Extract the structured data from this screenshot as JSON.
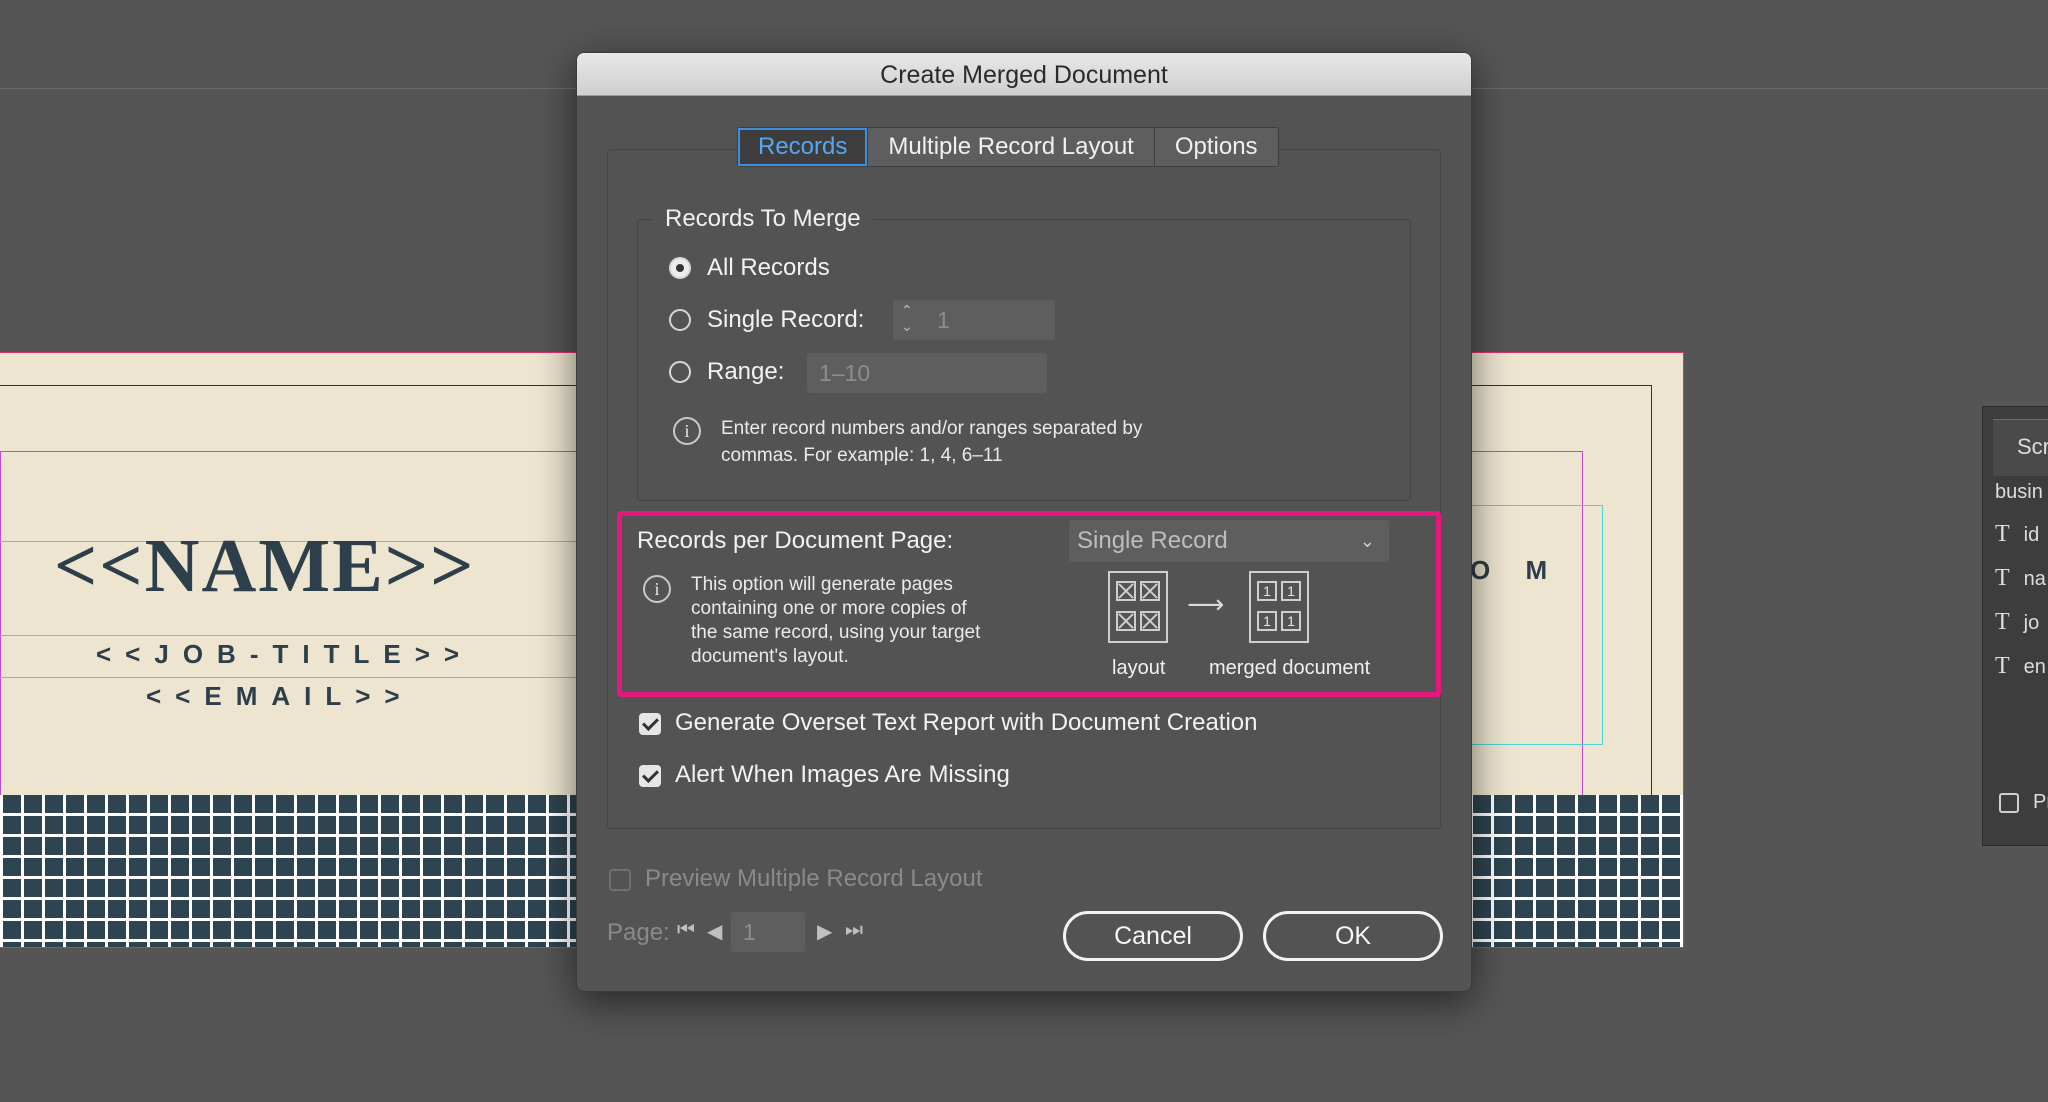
{
  "document": {
    "name_field": "<<NAME>>",
    "job_title_field": "<<JOB-TITLE>>",
    "email_field": "<<EMAIL>>",
    "fragment_text": "O M"
  },
  "script_panel": {
    "tab_label": "Scri",
    "header": "busin",
    "items": [
      {
        "type_glyph": "T",
        "label": "id"
      },
      {
        "type_glyph": "T",
        "label": "na"
      },
      {
        "type_glyph": "T",
        "label": "jo"
      },
      {
        "type_glyph": "T",
        "label": "en"
      }
    ],
    "checkbox_label": "Pr"
  },
  "dialog": {
    "title": "Create Merged Document",
    "tabs": [
      {
        "label": "Records",
        "active": true
      },
      {
        "label": "Multiple Record Layout",
        "active": false
      },
      {
        "label": "Options",
        "active": false
      }
    ],
    "records_to_merge": {
      "legend": "Records To Merge",
      "all_records_label": "All Records",
      "single_record_label": "Single Record:",
      "single_record_value": "1",
      "range_label": "Range:",
      "range_placeholder": "1–10",
      "selected": "All Records",
      "info_line1": "Enter record numbers and/or ranges separated by",
      "info_line2": "commas. For example: 1, 4, 6–11"
    },
    "records_per_page": {
      "label": "Records per Document Page:",
      "selected": "Single Record",
      "desc_line1": "This option will generate pages",
      "desc_line2": "containing one or more copies of",
      "desc_line3": "the same record, using your target",
      "desc_line4": "document's layout.",
      "diagram_cell_label": "1",
      "layout_caption": "layout",
      "merged_caption": "merged document",
      "highlight_color": "#e5197d"
    },
    "overset_report_label": "Generate Overset Text Report with Document Creation",
    "overset_report_checked": true,
    "alert_images_label": "Alert When Images Are Missing",
    "alert_images_checked": true,
    "preview_label": "Preview Multiple Record Layout",
    "preview_checked": false,
    "page_label": "Page:",
    "page_value": "1",
    "cancel_label": "Cancel",
    "ok_label": "OK"
  },
  "colors": {
    "accent_tab": "#56a7f0",
    "document_ink": "#2d3f4a",
    "document_paper": "#ede5cf"
  }
}
